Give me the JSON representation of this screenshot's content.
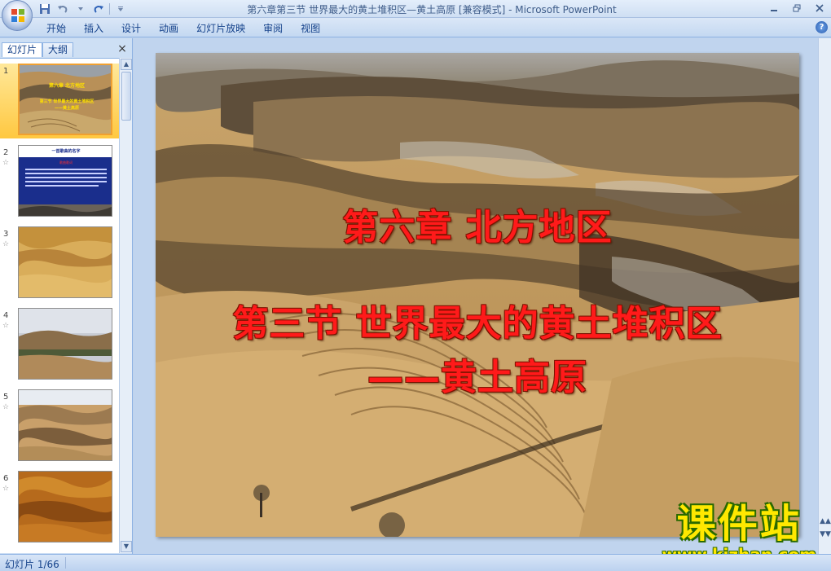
{
  "window": {
    "title": "第六章第三节 世界最大的黄土堆积区—黄土高原 [兼容模式]",
    "app_name": "Microsoft PowerPoint",
    "separator": " - "
  },
  "ribbon": {
    "tabs": [
      "开始",
      "插入",
      "设计",
      "动画",
      "幻灯片放映",
      "审阅",
      "视图"
    ],
    "help": "?"
  },
  "left_panel": {
    "tab_slides": "幻灯片",
    "tab_outline": "大纲",
    "close": "×",
    "thumbnails": [
      {
        "number": "1",
        "selected": true
      },
      {
        "number": "2",
        "star": "☆"
      },
      {
        "number": "3",
        "star": "☆"
      },
      {
        "number": "4",
        "star": "☆"
      },
      {
        "number": "5",
        "star": "☆"
      },
      {
        "number": "6",
        "star": "☆"
      }
    ]
  },
  "slide": {
    "line1": "第六章  北方地区",
    "line2": "第三节  世界最大的黄土堆积区",
    "line3": "——黄土高原"
  },
  "watermark": {
    "brand": "课件站",
    "url": "www.kjzhan.com"
  },
  "status": {
    "slide_counter": "幻灯片 1/66"
  },
  "colors": {
    "title_text": "#ff1a1a",
    "watermark_text": "#ffe800",
    "ribbon_bg": "#c4d8f1",
    "selected_thumb": "#ffc840"
  }
}
